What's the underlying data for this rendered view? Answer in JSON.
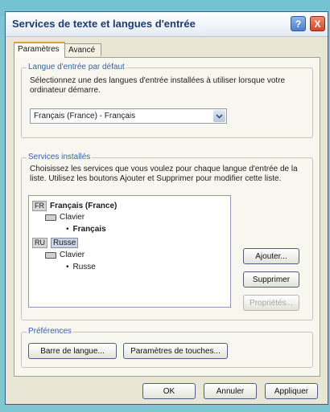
{
  "window": {
    "title": "Services de texte et langues d'entrée",
    "help_label": "?",
    "close_label": "X"
  },
  "tabs": [
    {
      "label": "Paramètres",
      "active": true
    },
    {
      "label": "Avancé",
      "active": false
    }
  ],
  "default_input_language": {
    "group_label": "Langue d'entrée par défaut",
    "description": "Sélectionnez une des langues d'entrée installées à utiliser lorsque votre ordinateur démarre.",
    "selected_value": "Français (France) - Français"
  },
  "installed_services": {
    "group_label": "Services installés",
    "description": "Choisissez les services que vous voulez pour chaque langue d'entrée de la liste. Utilisez les boutons Ajouter et Supprimer pour modifier cette liste.",
    "tree": [
      {
        "code": "FR",
        "language": "Français (France)",
        "category": "Clavier",
        "layout": "Français",
        "selected": false
      },
      {
        "code": "RU",
        "language": "Russe",
        "category": "Clavier",
        "layout": "Russe",
        "selected": true
      }
    ],
    "buttons": {
      "add": "Ajouter...",
      "remove": "Supprimer",
      "properties": "Propriétés..."
    }
  },
  "preferences": {
    "group_label": "Préférences",
    "language_bar_button": "Barre de langue...",
    "key_settings_button": "Paramètres de touches..."
  },
  "footer": {
    "ok": "OK",
    "cancel": "Annuler",
    "apply": "Appliquer"
  }
}
